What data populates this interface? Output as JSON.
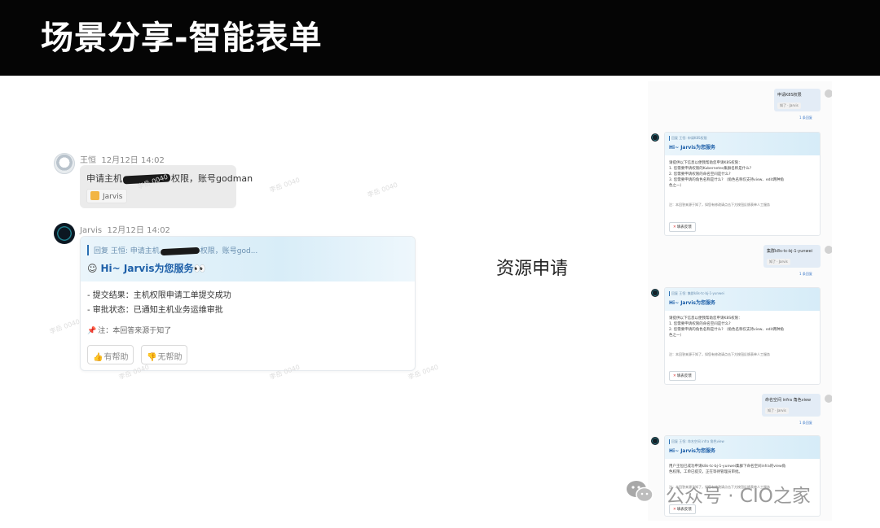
{
  "banner": {
    "title": "场景分享-智能表单"
  },
  "left_chat": {
    "user": {
      "name": "王恒",
      "time": "12月12日 14:02",
      "message_before": "申请主机",
      "message_after": "权限，账号godman",
      "chip_label": "Jarvis"
    },
    "bot": {
      "name": "Jarvis",
      "time": "12月12日 14:02",
      "reply_before": "回复 王恒: 申请主机",
      "reply_after": "权限，账号god...",
      "greeting": "Hi~ Jarvis为您服务",
      "greeting_emoji": "👀",
      "lines": [
        "- 提交结果：主机权限申请工单提交成功",
        "- 审批状态：已通知主机业务运维审批"
      ],
      "note": "注：本回答来源于知了",
      "helpful_label": "有帮助",
      "unhelpful_label": "无帮助"
    },
    "watermark": "李岳 0040"
  },
  "center_label": "资源申请",
  "thumb": {
    "read_label": "1 条回复",
    "feedback_label": "填表反馈",
    "chip_label": "知了 · Jarvis",
    "greeting": "Hi~ Jarvis为您服务",
    "user_msgs": [
      "申请K8S权限",
      "集群k8s-tc-bj-1-yunwei",
      "命名空间 infra 角色view"
    ],
    "cards": [
      {
        "reply": "回复 王恒: 申请K8S权限",
        "body": [
          "请提供以下信息以便我帮助您申请K8S权限：",
          "1. 您需要申请权限的Kubernetes集群名称是什么?",
          "2. 您需要申请权限的命名空间是什么?",
          "3. 您需要申请的角色名称是什么? （角色名称仅支持view、edit两种角",
          "色之一）"
        ],
        "note": "注：本回答来源于知了，如您有修改请点击下方按钮反馈表单人工服务"
      },
      {
        "reply": "回复 王恒: 集群k8s-tc-bj-1-yunwei",
        "body": [
          "请提供以下信息以便我帮助您申请K8S权限：",
          "1. 您需要申请权限的命名空间是什么?",
          "2. 您需要申请的角色名称是什么? （角色名称仅支持view、edit两种角",
          "色之一）"
        ],
        "note": "注：本回答来源于知了，如您有修改请点击下方按钮反馈表单人工服务"
      },
      {
        "reply": "回复 王恒: 命名空间 infra 角色view",
        "body": [
          "用户王恒已成功申请k8s-tc-bj-1-yunwei集群下命名空间infra的view角",
          "色权限，工单已提交，正在等待管理员审批。"
        ],
        "note": "注：本回答来源于知了，如您有修改请点击下方按钮反馈表单人工服务"
      }
    ]
  },
  "footer": {
    "text": "公众号 · CIO之家"
  }
}
